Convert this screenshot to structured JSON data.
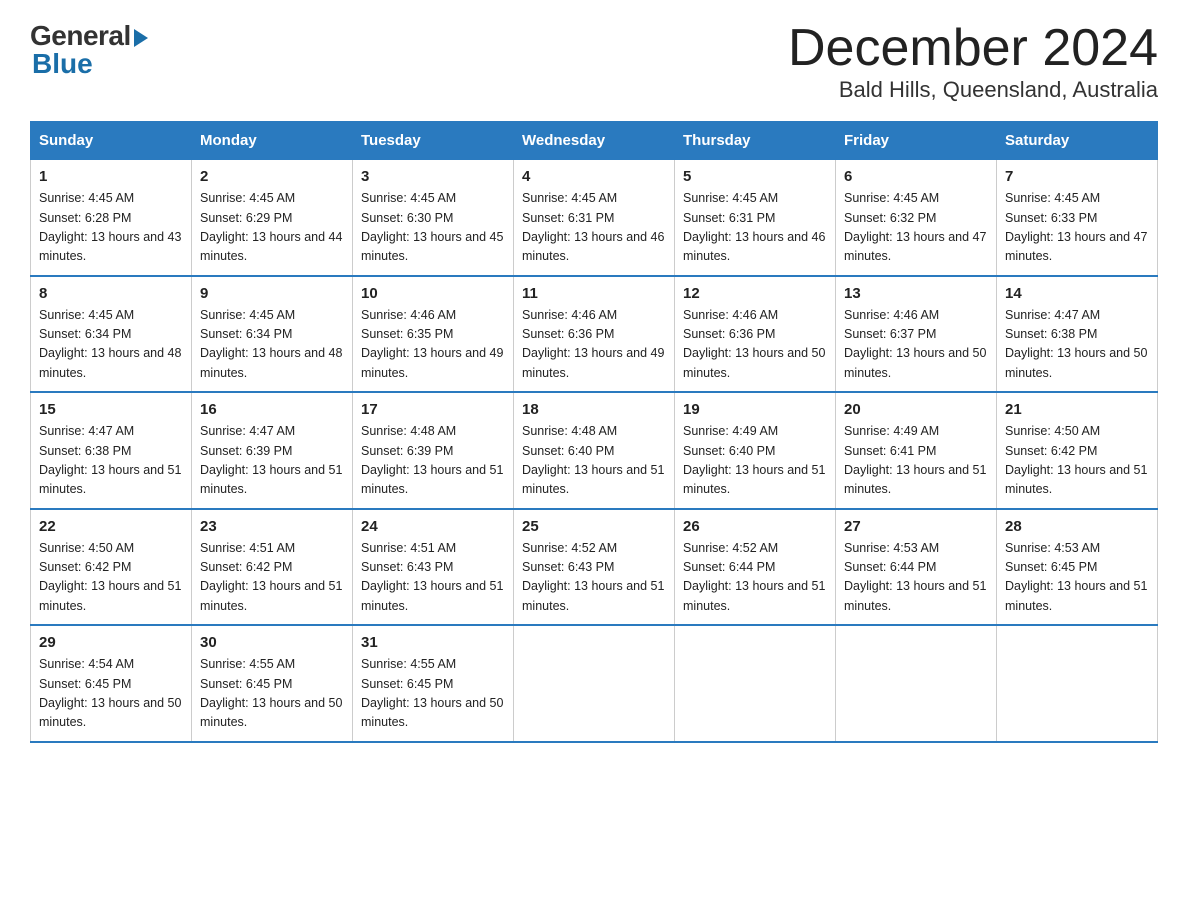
{
  "header": {
    "logo_general": "General",
    "logo_blue": "Blue",
    "month_title": "December 2024",
    "location": "Bald Hills, Queensland, Australia"
  },
  "days_of_week": [
    "Sunday",
    "Monday",
    "Tuesday",
    "Wednesday",
    "Thursday",
    "Friday",
    "Saturday"
  ],
  "weeks": [
    [
      {
        "num": "1",
        "sunrise": "4:45 AM",
        "sunset": "6:28 PM",
        "daylight": "13 hours and 43 minutes."
      },
      {
        "num": "2",
        "sunrise": "4:45 AM",
        "sunset": "6:29 PM",
        "daylight": "13 hours and 44 minutes."
      },
      {
        "num": "3",
        "sunrise": "4:45 AM",
        "sunset": "6:30 PM",
        "daylight": "13 hours and 45 minutes."
      },
      {
        "num": "4",
        "sunrise": "4:45 AM",
        "sunset": "6:31 PM",
        "daylight": "13 hours and 46 minutes."
      },
      {
        "num": "5",
        "sunrise": "4:45 AM",
        "sunset": "6:31 PM",
        "daylight": "13 hours and 46 minutes."
      },
      {
        "num": "6",
        "sunrise": "4:45 AM",
        "sunset": "6:32 PM",
        "daylight": "13 hours and 47 minutes."
      },
      {
        "num": "7",
        "sunrise": "4:45 AM",
        "sunset": "6:33 PM",
        "daylight": "13 hours and 47 minutes."
      }
    ],
    [
      {
        "num": "8",
        "sunrise": "4:45 AM",
        "sunset": "6:34 PM",
        "daylight": "13 hours and 48 minutes."
      },
      {
        "num": "9",
        "sunrise": "4:45 AM",
        "sunset": "6:34 PM",
        "daylight": "13 hours and 48 minutes."
      },
      {
        "num": "10",
        "sunrise": "4:46 AM",
        "sunset": "6:35 PM",
        "daylight": "13 hours and 49 minutes."
      },
      {
        "num": "11",
        "sunrise": "4:46 AM",
        "sunset": "6:36 PM",
        "daylight": "13 hours and 49 minutes."
      },
      {
        "num": "12",
        "sunrise": "4:46 AM",
        "sunset": "6:36 PM",
        "daylight": "13 hours and 50 minutes."
      },
      {
        "num": "13",
        "sunrise": "4:46 AM",
        "sunset": "6:37 PM",
        "daylight": "13 hours and 50 minutes."
      },
      {
        "num": "14",
        "sunrise": "4:47 AM",
        "sunset": "6:38 PM",
        "daylight": "13 hours and 50 minutes."
      }
    ],
    [
      {
        "num": "15",
        "sunrise": "4:47 AM",
        "sunset": "6:38 PM",
        "daylight": "13 hours and 51 minutes."
      },
      {
        "num": "16",
        "sunrise": "4:47 AM",
        "sunset": "6:39 PM",
        "daylight": "13 hours and 51 minutes."
      },
      {
        "num": "17",
        "sunrise": "4:48 AM",
        "sunset": "6:39 PM",
        "daylight": "13 hours and 51 minutes."
      },
      {
        "num": "18",
        "sunrise": "4:48 AM",
        "sunset": "6:40 PM",
        "daylight": "13 hours and 51 minutes."
      },
      {
        "num": "19",
        "sunrise": "4:49 AM",
        "sunset": "6:40 PM",
        "daylight": "13 hours and 51 minutes."
      },
      {
        "num": "20",
        "sunrise": "4:49 AM",
        "sunset": "6:41 PM",
        "daylight": "13 hours and 51 minutes."
      },
      {
        "num": "21",
        "sunrise": "4:50 AM",
        "sunset": "6:42 PM",
        "daylight": "13 hours and 51 minutes."
      }
    ],
    [
      {
        "num": "22",
        "sunrise": "4:50 AM",
        "sunset": "6:42 PM",
        "daylight": "13 hours and 51 minutes."
      },
      {
        "num": "23",
        "sunrise": "4:51 AM",
        "sunset": "6:42 PM",
        "daylight": "13 hours and 51 minutes."
      },
      {
        "num": "24",
        "sunrise": "4:51 AM",
        "sunset": "6:43 PM",
        "daylight": "13 hours and 51 minutes."
      },
      {
        "num": "25",
        "sunrise": "4:52 AM",
        "sunset": "6:43 PM",
        "daylight": "13 hours and 51 minutes."
      },
      {
        "num": "26",
        "sunrise": "4:52 AM",
        "sunset": "6:44 PM",
        "daylight": "13 hours and 51 minutes."
      },
      {
        "num": "27",
        "sunrise": "4:53 AM",
        "sunset": "6:44 PM",
        "daylight": "13 hours and 51 minutes."
      },
      {
        "num": "28",
        "sunrise": "4:53 AM",
        "sunset": "6:45 PM",
        "daylight": "13 hours and 51 minutes."
      }
    ],
    [
      {
        "num": "29",
        "sunrise": "4:54 AM",
        "sunset": "6:45 PM",
        "daylight": "13 hours and 50 minutes."
      },
      {
        "num": "30",
        "sunrise": "4:55 AM",
        "sunset": "6:45 PM",
        "daylight": "13 hours and 50 minutes."
      },
      {
        "num": "31",
        "sunrise": "4:55 AM",
        "sunset": "6:45 PM",
        "daylight": "13 hours and 50 minutes."
      },
      null,
      null,
      null,
      null
    ]
  ],
  "labels": {
    "sunrise_prefix": "Sunrise: ",
    "sunset_prefix": "Sunset: ",
    "daylight_prefix": "Daylight: "
  }
}
